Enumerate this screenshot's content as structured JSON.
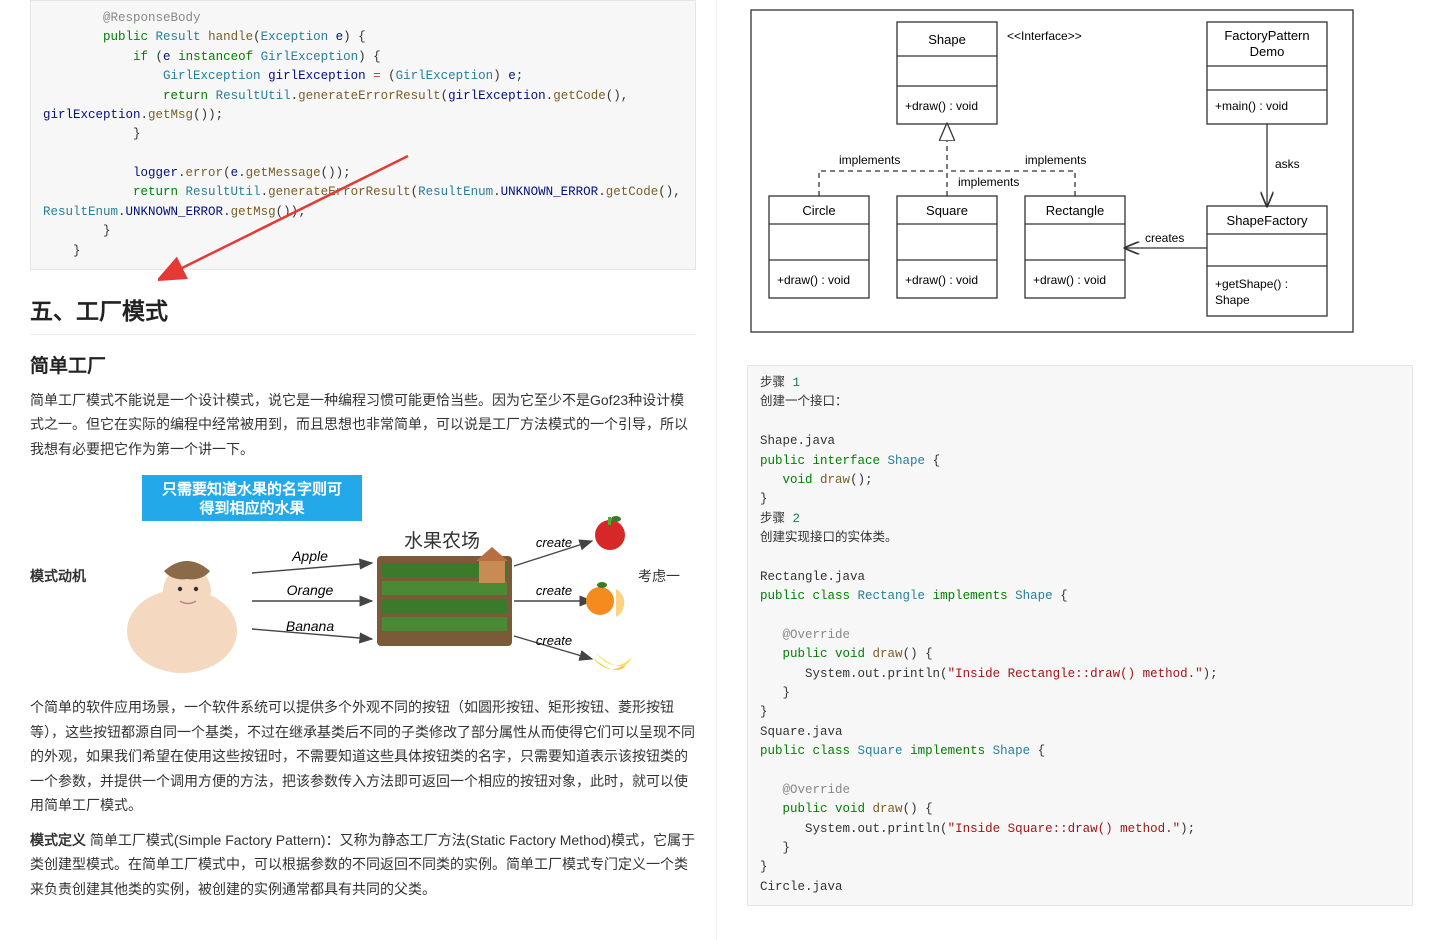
{
  "code1": {
    "l1": "@ResponseBody",
    "l2_kw": "public",
    "l2_type": "Result",
    "l2_fn": "handle",
    "l2_arg_t": "Exception",
    "l2_arg_n": "e",
    "l3_kw": "if",
    "l3_name": "e",
    "l3_kw2": "instanceof",
    "l3_type": "GirlException",
    "l4_type": "GirlException",
    "l4_name": "girlException",
    "l4_op": "=",
    "l4_type2": "GirlException",
    "l4_e": "e",
    "l5_kw": "return",
    "l5_type": "ResultUtil",
    "l5_fn": "generateErrorResult",
    "l5_a": "girlException",
    "l5_fn2": "getCode",
    "l6_a": "girlException",
    "l6_fn": "getMsg",
    "l9_a": "logger",
    "l9_fn": "error",
    "l9_b": "e",
    "l9_fn2": "getMessage",
    "l10_kw": "return",
    "l10_type": "ResultUtil",
    "l10_fn": "generateErrorResult",
    "l10_type2": "ResultEnum",
    "l10_c": "UNKNOWN_ERROR",
    "l10_fn2": "getCode",
    "l11_type": "ResultEnum",
    "l11_c": "UNKNOWN_ERROR",
    "l11_fn": "getMsg"
  },
  "h_factory": "五、工厂模式",
  "h_simple": "简单工厂",
  "p1": "简单工厂模式不能说是一个设计模式，说它是一种编程习惯可能更恰当些。因为它至少不是Gof23种设计模式之一。但它在实际的编程中经常被用到，而且思想也非常简单，可以说是工厂方法模式的一个引导，所以我想有必要把它作为第一个讲一下。",
  "illus": {
    "banner_top": "只需要知道水果的名字则可",
    "banner_bot": "得到相应的水果",
    "farm_title": "水果农场",
    "apple": "Apple",
    "orange": "Orange",
    "banana": "Banana",
    "create": "create",
    "left_label": "模式动机",
    "right_label": "考虑一"
  },
  "p2": "个简单的软件应用场景，一个软件系统可以提供多个外观不同的按钮（如圆形按钮、矩形按钮、菱形按钮等），这些按钮都源自同一个基类，不过在继承基类后不同的子类修改了部分属性从而使得它们可以呈现不同的外观，如果我们希望在使用这些按钮时，不需要知道这些具体按钮类的名字，只需要知道表示该按钮类的一个参数，并提供一个调用方便的方法，把该参数传入方法即可返回一个相应的按钮对象，此时，就可以使用简单工厂模式。",
  "p3_strong": "模式定义",
  "p3": " 简单工厂模式(Simple Factory Pattern)：又称为静态工厂方法(Static Factory Method)模式，它属于类创建型模式。在简单工厂模式中，可以根据参数的不同返回不同类的实例。简单工厂模式专门定义一个类来负责创建其他类的实例，被创建的实例通常都具有共同的父类。",
  "uml": {
    "shape": "Shape",
    "iface": "<<Interface>>",
    "draw": "+draw() : void",
    "circle": "Circle",
    "square": "Square",
    "rectangle": "Rectangle",
    "demo": "FactoryPattern\nDemo",
    "demo1": "FactoryPattern",
    "demo2": "Demo",
    "main": "+main() : void",
    "factory": "ShapeFactory",
    "getshape1": "+getShape() :",
    "getshape2": "Shape",
    "impl": "implements",
    "asks": "asks",
    "creates": "creates"
  },
  "code2": {
    "s1a": "步骤 ",
    "s1n": "1",
    "s1b": "创建一个接口：",
    "shjava": "Shape.java",
    "pi_kw": "public interface",
    "pi_type": "Shape",
    "vd_kw": "void",
    "vd_fn": "draw",
    "s2a": "步骤 ",
    "s2n": "2",
    "s2b": "创建实现接口的实体类。",
    "recjava": "Rectangle.java",
    "pc_kw": "public class",
    "pc_rec": "Rectangle",
    "pc_impl": "implements",
    "pc_shape": "Shape",
    "ov": "@Override",
    "pvd_kw": "public void",
    "pvd_fn": "draw",
    "sys": "System.out.println",
    "str_rec": "\"Inside Rectangle::draw() method.\"",
    "sqjava": "Square.java",
    "pc_sq": "Square",
    "str_sq": "\"Inside Square::draw() method.\"",
    "cjava": "Circle.java"
  }
}
